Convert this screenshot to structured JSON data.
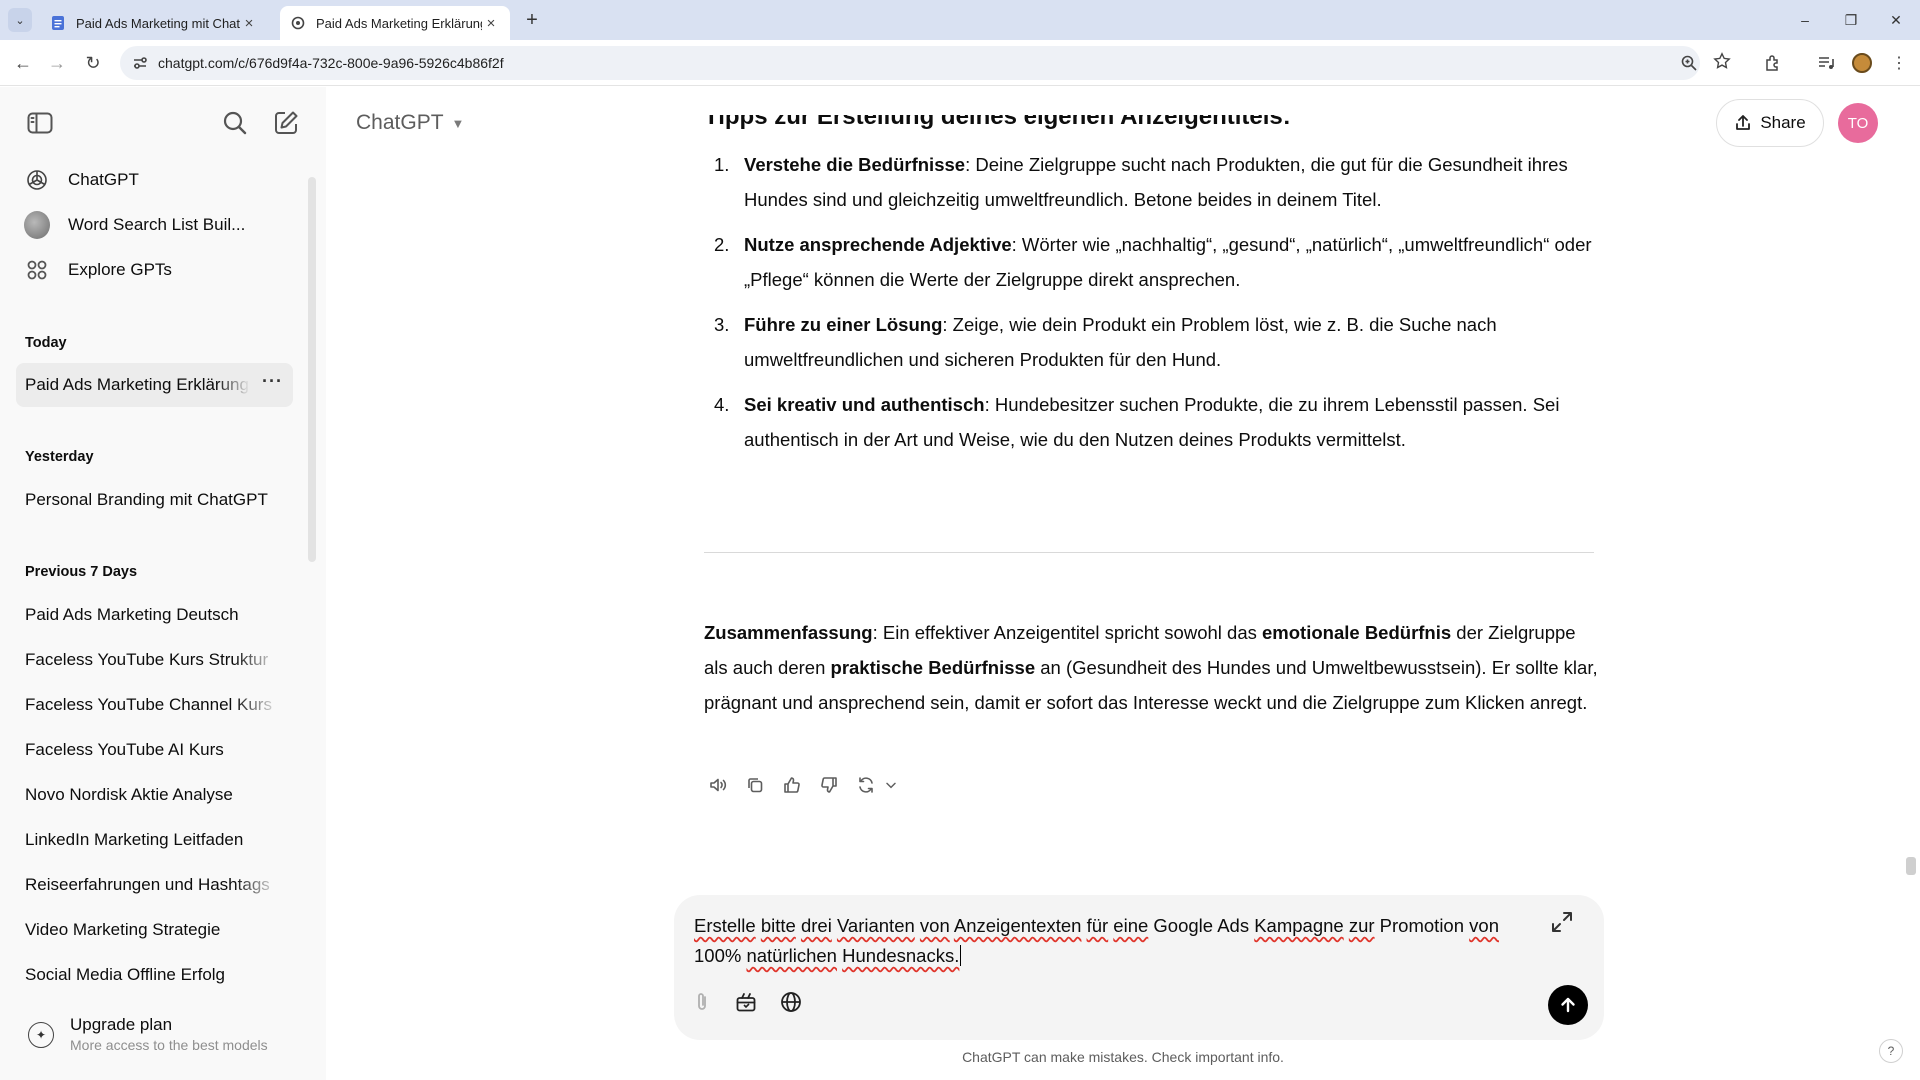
{
  "browser": {
    "tabs": [
      {
        "title": "Paid Ads Marketing mit ChatGPT",
        "active": false
      },
      {
        "title": "Paid Ads Marketing Erklärung",
        "active": true
      }
    ],
    "url": "chatgpt.com/c/676d9f4a-732c-800e-9a96-5926c4b86f2f"
  },
  "sidebar": {
    "top_items": [
      {
        "label": "ChatGPT",
        "icon": "openai-logo-icon"
      },
      {
        "label": "Word Search List Buil...",
        "icon": "gpt-avatar"
      },
      {
        "label": "Explore GPTs",
        "icon": "grid-icon"
      }
    ],
    "sections": {
      "today": "Today",
      "yesterday": "Yesterday",
      "previous": "Previous 7 Days"
    },
    "today_items": [
      {
        "label": "Paid Ads Marketing Erklärung",
        "more": "···"
      }
    ],
    "yesterday_items": [
      {
        "label": "Personal Branding mit ChatGPT"
      }
    ],
    "previous_items": [
      {
        "label": "Paid Ads Marketing Deutsch"
      },
      {
        "label": "Faceless YouTube Kurs Struktur"
      },
      {
        "label": "Faceless YouTube Channel Kurs"
      },
      {
        "label": "Faceless YouTube AI Kurs"
      },
      {
        "label": "Novo Nordisk Aktie Analyse"
      },
      {
        "label": "LinkedIn Marketing Leitfaden"
      },
      {
        "label": "Reiseerfahrungen und Hashtags"
      },
      {
        "label": "Video Marketing Strategie"
      },
      {
        "label": "Social Media Offline Erfolg"
      }
    ],
    "upgrade": {
      "title": "Upgrade plan",
      "subtitle": "More access to the best models"
    }
  },
  "header": {
    "model": "ChatGPT",
    "share": "Share",
    "avatar_initials": "TO"
  },
  "response": {
    "heading": "Tipps zur Erstellung deines eigenen Anzeigentitels:",
    "tips": [
      {
        "num": "1.",
        "bold": "Verstehe die Bedürfnisse",
        "text": ": Deine Zielgruppe sucht nach Produkten, die gut für die Gesundheit ihres Hundes sind und gleichzeitig umweltfreundlich. Betone beides in deinem Titel."
      },
      {
        "num": "2.",
        "bold": "Nutze ansprechende Adjektive",
        "text": ": Wörter wie „nachhaltig“, „gesund“, „natürlich“, „umweltfreundlich“ oder „Pflege“ können die Werte der Zielgruppe direkt ansprechen."
      },
      {
        "num": "3.",
        "bold": "Führe zu einer Lösung",
        "text": ": Zeige, wie dein Produkt ein Problem löst, wie z. B. die Suche nach umweltfreundlichen und sicheren Produkten für den Hund."
      },
      {
        "num": "4.",
        "bold": "Sei kreativ und authentisch",
        "text": ": Hundebesitzer suchen Produkte, die zu ihrem Lebensstil passen. Sei authentisch in der Art und Weise, wie du den Nutzen deines Produkts vermittelst."
      }
    ],
    "summary": {
      "label": "Zusammenfassung",
      "p1": ": Ein effektiver Anzeigentitel spricht sowohl das ",
      "b1": "emotionale Bedürfnis",
      "p2": " der Zielgruppe als auch deren ",
      "b2": "praktische Bedürfnisse",
      "p3": " an (Gesundheit des Hundes und Umweltbewusstsein). Er sollte klar, prägnant und ansprechend sein, damit er sofort das Interesse weckt und die Zielgruppe zum Klicken anregt."
    }
  },
  "composer": {
    "w1": "Erstelle",
    "w2": "bitte",
    "w3": "drei",
    "w4": "Varianten",
    "w5": "von",
    "w6": "Anzeigentexten",
    "w7": "für",
    "w8": "eine",
    "t1": " Google Ads ",
    "w9": "Kampagne",
    "w10": "zur",
    "t2": " Promotion ",
    "w11": "von",
    "t3": " 100% ",
    "w12": "natürlichen",
    "w13": "Hundesnacks."
  },
  "footer": {
    "disclaimer": "ChatGPT can make mistakes. Check important info.",
    "help": "?"
  }
}
